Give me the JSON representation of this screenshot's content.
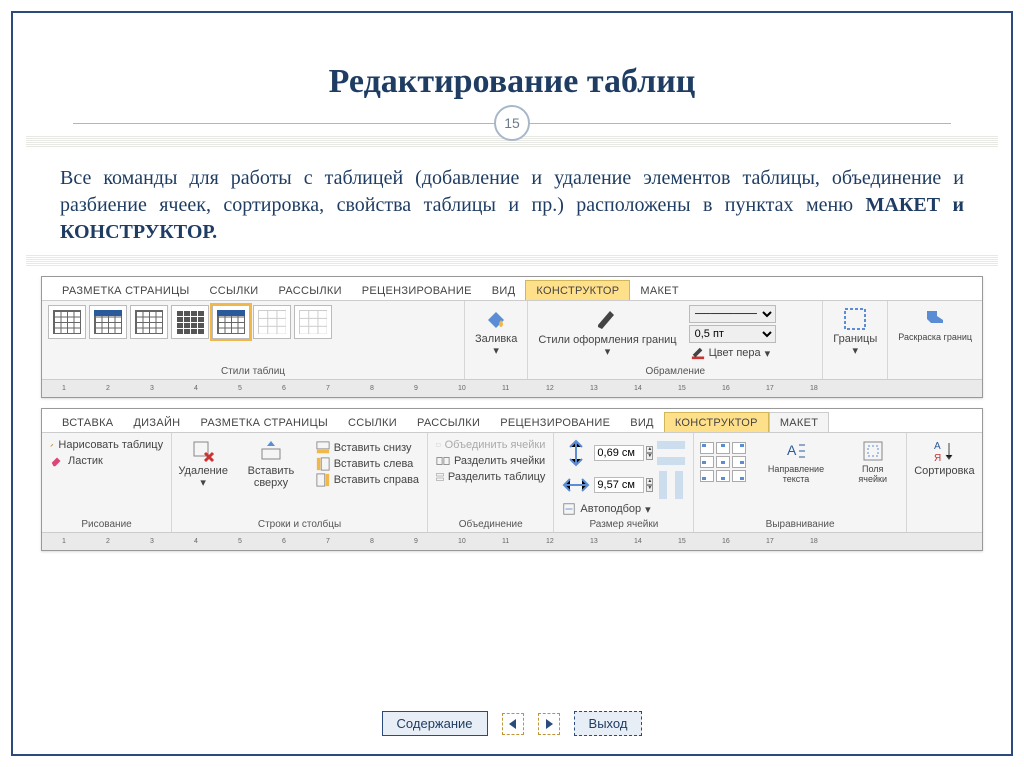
{
  "slide": {
    "title": "Редактирование таблиц",
    "page_number": "15",
    "body_text": "Все команды для работы с таблицей (добавление и удаление элементов таблицы, объединение и разбиение ячеек, сортировка, свойства таблицы и пр.) расположены в пунктах меню ",
    "body_bold": "МАКЕТ и КОНСТРУКТОР."
  },
  "ribbon1": {
    "tabs": [
      "РАЗМЕТКА СТРАНИЦЫ",
      "ССЫЛКИ",
      "РАССЫЛКИ",
      "РЕЦЕНЗИРОВАНИЕ",
      "ВИД",
      "КОНСТРУКТОР",
      "МАКЕТ"
    ],
    "highlight_tab_index": 5,
    "group_styles": "Стили таблиц",
    "fill_label": "Заливка",
    "border_styles_label": "Стили оформления границ",
    "weight_value": "0,5 пт",
    "pen_color_label": "Цвет пера",
    "group_border": "Обрамление",
    "borders_btn": "Границы",
    "painter_btn": "Раскраска границ",
    "ruler_ticks": [
      "1",
      "2",
      "3",
      "4",
      "5",
      "6",
      "7",
      "8",
      "9",
      "10",
      "11",
      "12",
      "13",
      "14",
      "15",
      "16",
      "17",
      "18"
    ]
  },
  "ribbon2": {
    "tabs": [
      "ВСТАВКА",
      "ДИЗАЙН",
      "РАЗМЕТКА СТРАНИЦЫ",
      "ССЫЛКИ",
      "РАССЫЛКИ",
      "РЕЦЕНЗИРОВАНИЕ",
      "ВИД",
      "КОНСТРУКТОР",
      "МАКЕТ"
    ],
    "highlight_tab_index": 8,
    "yellow_tab_index": 7,
    "draw_table": "Нарисовать таблицу",
    "eraser": "Ластик",
    "group_drawing": "Рисование",
    "delete_btn": "Удаление",
    "insert_above": "Вставить сверху",
    "insert_below": "Вставить снизу",
    "insert_left": "Вставить слева",
    "insert_right": "Вставить справа",
    "group_rows_cols": "Строки и столбцы",
    "merge_cells": "Объединить ячейки",
    "split_cells": "Разделить ячейки",
    "split_table": "Разделить таблицу",
    "group_merge": "Объединение",
    "height_val": "0,69 см",
    "width_val": "9,57 см",
    "autofit": "Автоподбор",
    "group_cell_size": "Размер ячейки",
    "text_direction": "Направление текста",
    "cell_margins": "Поля ячейки",
    "group_align": "Выравнивание",
    "sort_btn": "Сортировка"
  },
  "footer": {
    "contents": "Содержание",
    "exit": "Выход"
  }
}
